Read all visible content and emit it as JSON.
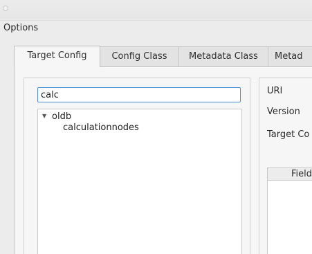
{
  "menu": {
    "options_label": "Options"
  },
  "tabs": [
    {
      "label": "Target Config"
    },
    {
      "label": "Config Class"
    },
    {
      "label": "Metadata Class"
    },
    {
      "label": "Metad"
    }
  ],
  "left": {
    "search_value": "calc",
    "tree": {
      "root_label": "oldb",
      "child_label": "calculationnodes"
    }
  },
  "right": {
    "uri_label": "URI",
    "version_label": "Version",
    "target_config_label": "Target Co",
    "field_header": "Field"
  }
}
